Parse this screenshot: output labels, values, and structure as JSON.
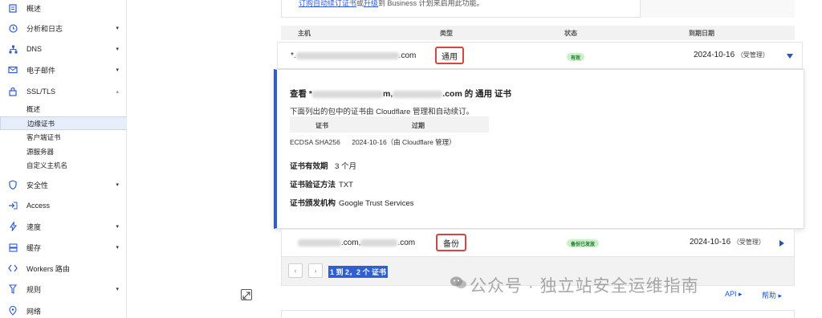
{
  "sidebar": {
    "items": [
      {
        "label": "概述",
        "icon": "document-icon"
      },
      {
        "label": "分析和日志",
        "icon": "clock-icon",
        "caret": "▾"
      },
      {
        "label": "DNS",
        "icon": "network-icon",
        "caret": "▾"
      },
      {
        "label": "电子邮件",
        "icon": "mail-icon",
        "caret": "▾"
      },
      {
        "label": "SSL/TLS",
        "icon": "lock-icon",
        "caret": "▴"
      },
      {
        "label": "安全性",
        "icon": "shield-icon",
        "caret": "▾"
      },
      {
        "label": "Access",
        "icon": "access-icon"
      },
      {
        "label": "速度",
        "icon": "bolt-icon",
        "caret": "▾"
      },
      {
        "label": "缓存",
        "icon": "cache-icon",
        "caret": "▾"
      },
      {
        "label": "Workers 路由",
        "icon": "workers-icon"
      },
      {
        "label": "规则",
        "icon": "rules-icon",
        "caret": "▾"
      },
      {
        "label": "网络",
        "icon": "location-icon"
      }
    ],
    "ssl_sub_items": [
      "概述",
      "边缘证书",
      "客户端证书",
      "源服务器",
      "自定义主机名"
    ],
    "active_sub_item": "边缘证书"
  },
  "top_notice": {
    "link1": "订购自动续订证书",
    "middle": "或",
    "link2": "升级",
    "tail": "到 Business 计划来启用此功能。"
  },
  "table": {
    "headers": {
      "host": "主机",
      "type": "类型",
      "status": "状态",
      "expiry": "到期日期"
    },
    "rows": [
      {
        "host_prefix": "*.",
        "host_suffix": ".com",
        "type": "通用",
        "status": "有效",
        "expiry": "2024-10-16",
        "managed": "（受管理）"
      },
      {
        "host_prefix": "",
        "host_mid": ".com,",
        "host_suffix": ".com",
        "type": "备份",
        "status": "备份已发放",
        "expiry": "2024-10-16",
        "managed": "（受管理）"
      }
    ]
  },
  "detail": {
    "heading_prefix": "查看 *",
    "heading_mid": "m,",
    "heading_suffix": ".com 的 通用 证书",
    "description": "下面列出的包中的证书由 Cloudflare 管理和自动续订。",
    "mini_headers": {
      "cert": "证书",
      "expiry": "过期"
    },
    "cert_row": {
      "cert": "ECDSA SHA256",
      "expiry": "2024-10-16（由 Cloudflare 管理）"
    },
    "validity_label": "证书有效期",
    "validity_value": "3 个月",
    "method_label": "证书验证方法",
    "method_value": "TXT",
    "issuer_label": "证书颁发机构",
    "issuer_value": "Google Trust Services"
  },
  "pager": {
    "prev": "‹",
    "next": "›",
    "summary": "1 到 2，2 个 证书"
  },
  "footer": {
    "api": "API ▸",
    "help": "帮助 ▸"
  },
  "watermark": "公众号 · 独立站安全运维指南",
  "colors": {
    "accent": "#2d5bd4",
    "highlight_box": "#d64545",
    "status_green": "#c9f0c9"
  }
}
